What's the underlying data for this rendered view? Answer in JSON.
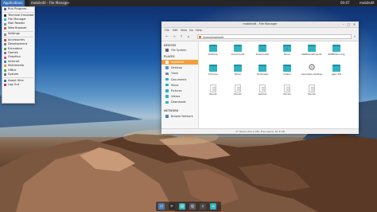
{
  "top_panel": {
    "applications_label": "Applications",
    "task_label": "mobiledit - File Manager",
    "clock": "00:07",
    "user": "mobiledit"
  },
  "app_menu": {
    "items": [
      {
        "label": "Run Program...",
        "color": "#3b6fb6"
      },
      {
        "sep": true
      },
      {
        "label": "Terminal Emulator",
        "color": "#333333"
      },
      {
        "label": "File Manager",
        "color": "#2fb3c3"
      },
      {
        "label": "Mail Reader",
        "color": "#5a8fd6"
      },
      {
        "label": "Web Browser",
        "color": "#d0662c"
      },
      {
        "sep": true
      },
      {
        "label": "Settings",
        "color": "#888888"
      },
      {
        "sep": true
      },
      {
        "label": "Accessories",
        "color": "#c44f3a"
      },
      {
        "label": "Development",
        "color": "#6c7d8c"
      },
      {
        "label": "Education",
        "color": "#4aa64a"
      },
      {
        "label": "Games",
        "color": "#8a5fb8"
      },
      {
        "label": "Graphics",
        "color": "#d44d8a"
      },
      {
        "label": "Internet",
        "color": "#3b88d6"
      },
      {
        "label": "Multimedia",
        "color": "#d6a13b"
      },
      {
        "label": "Office",
        "color": "#5baa5b"
      },
      {
        "label": "System",
        "color": "#737373"
      },
      {
        "sep": true
      },
      {
        "label": "About Xfce",
        "color": "#3b6fb6"
      },
      {
        "label": "Log Out",
        "color": "#c03a3a"
      }
    ]
  },
  "file_manager": {
    "title": "mobiledit - File Manager",
    "menu": [
      "File",
      "Edit",
      "View",
      "Go",
      "Help"
    ],
    "path": "/home/mobiledit",
    "sidebar": {
      "devices_header": "DEVICES",
      "devices": [
        {
          "label": "File System",
          "icon": "drive-icon"
        }
      ],
      "places_header": "PLACES",
      "places": [
        {
          "label": "mobiledit",
          "icon": "home-icon",
          "active": true
        },
        {
          "label": "Desktop",
          "icon": "desktop-icon"
        },
        {
          "label": "Trash",
          "icon": "trash-icon"
        },
        {
          "label": "Documents",
          "icon": "folder-icon"
        },
        {
          "label": "Music",
          "icon": "folder-icon"
        },
        {
          "label": "Pictures",
          "icon": "folder-icon"
        },
        {
          "label": "Videos",
          "icon": "folder-icon"
        },
        {
          "label": "Downloads",
          "icon": "folder-icon"
        }
      ],
      "network_header": "NETWORK",
      "network": [
        {
          "label": "Browse Network",
          "icon": "network-icon"
        }
      ]
    },
    "files": [
      {
        "name": "Desktop",
        "kind": "folder",
        "glyph": ""
      },
      {
        "name": "Documents",
        "kind": "folder",
        "glyph": ""
      },
      {
        "name": "Downloads",
        "kind": "folder",
        "glyph": "↓"
      },
      {
        "name": "Music",
        "kind": "folder",
        "glyph": "♪"
      },
      {
        "name": "NetBeansProjects",
        "kind": "folder",
        "glyph": ""
      },
      {
        "name": "SMBShare.img",
        "kind": "folder",
        "glyph": ""
      },
      {
        "name": "Pictures",
        "kind": "folder",
        "glyph": ""
      },
      {
        "name": "Public",
        "kind": "folder",
        "glyph": ""
      },
      {
        "name": "Templates",
        "kind": "folder",
        "glyph": ""
      },
      {
        "name": "Videos",
        "kind": "folder",
        "glyph": ""
      },
      {
        "name": "examples.desktop",
        "kind": "gear",
        "glyph": "⚙"
      },
      {
        "name": "gpjri.dat",
        "kind": "folder",
        "glyph": ""
      },
      {
        "name": "file.txt",
        "kind": "doc",
        "glyph": ""
      },
      {
        "name": "file.txt",
        "kind": "doc",
        "glyph": ""
      },
      {
        "name": "text.txt",
        "kind": "doc",
        "glyph": ""
      },
      {
        "name": "file.txt",
        "kind": "doc",
        "glyph": ""
      },
      {
        "name": "file.txt",
        "kind": "doc",
        "glyph": ""
      }
    ],
    "status": "17 items (201.0 kB), Free space: 87.8 GB"
  },
  "dock": {
    "items": [
      {
        "name": "show-desktop",
        "color": "#4a7fb8",
        "glyph": "▭"
      },
      {
        "name": "terminal",
        "color": "#2b2b2b",
        "glyph": ">"
      },
      {
        "name": "file-manager",
        "color": "#2fb3c3",
        "glyph": "▤"
      },
      {
        "name": "web-browser",
        "color": "#5a5a6e",
        "glyph": "◎"
      },
      {
        "name": "app-finder",
        "color": "#4a4a4a",
        "glyph": "⌕"
      },
      {
        "name": "home-folder",
        "color": "#2fb3c3",
        "glyph": "⌂"
      }
    ]
  }
}
